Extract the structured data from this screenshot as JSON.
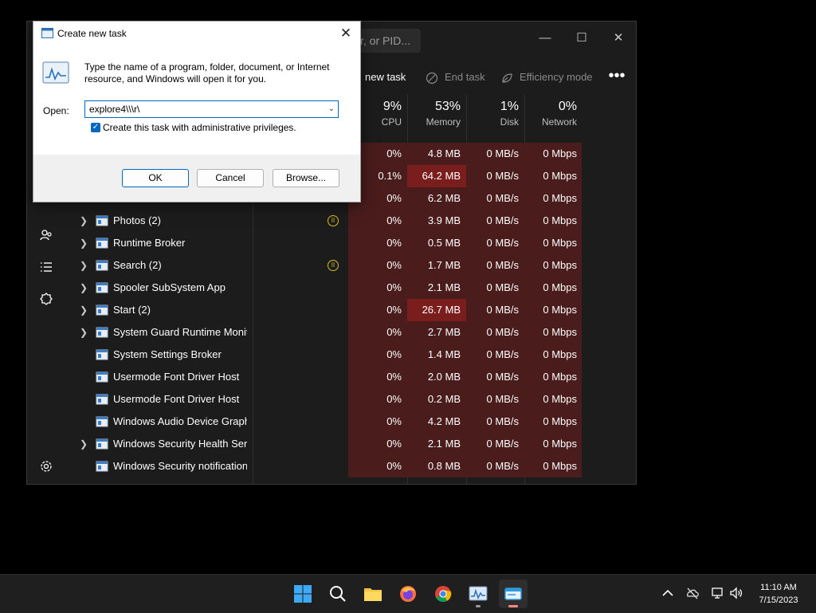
{
  "task_manager": {
    "search_placeholder": "r, or PID...",
    "toolbar": {
      "run_new_task": "new task",
      "end_task": "End task",
      "efficiency_mode": "Efficiency mode",
      "more": "•••"
    },
    "columns": [
      {
        "pct": "9%",
        "label": "CPU"
      },
      {
        "pct": "53%",
        "label": "Memory"
      },
      {
        "pct": "1%",
        "label": "Disk"
      },
      {
        "pct": "0%",
        "label": "Network"
      }
    ],
    "rows": [
      {
        "name": "",
        "expand": false,
        "cpu": "0%",
        "memory": "4.8 MB",
        "disk": "0 MB/s",
        "network": "0 Mbps",
        "mem_high": false,
        "paused": false
      },
      {
        "name": "",
        "expand": false,
        "cpu": "0.1%",
        "memory": "64.2 MB",
        "disk": "0 MB/s",
        "network": "0 Mbps",
        "mem_high": true,
        "paused": false
      },
      {
        "name": "",
        "expand": false,
        "cpu": "0%",
        "memory": "6.2 MB",
        "disk": "0 MB/s",
        "network": "0 Mbps",
        "mem_high": false,
        "paused": false
      },
      {
        "name": "Photos (2)",
        "expand": true,
        "cpu": "0%",
        "memory": "3.9 MB",
        "disk": "0 MB/s",
        "network": "0 Mbps",
        "mem_high": false,
        "paused": true
      },
      {
        "name": "Runtime Broker",
        "expand": true,
        "cpu": "0%",
        "memory": "0.5 MB",
        "disk": "0 MB/s",
        "network": "0 Mbps",
        "mem_high": false,
        "paused": false
      },
      {
        "name": "Search (2)",
        "expand": true,
        "cpu": "0%",
        "memory": "1.7 MB",
        "disk": "0 MB/s",
        "network": "0 Mbps",
        "mem_high": false,
        "paused": true
      },
      {
        "name": "Spooler SubSystem App",
        "expand": true,
        "cpu": "0%",
        "memory": "2.1 MB",
        "disk": "0 MB/s",
        "network": "0 Mbps",
        "mem_high": false,
        "paused": false
      },
      {
        "name": "Start (2)",
        "expand": true,
        "cpu": "0%",
        "memory": "26.7 MB",
        "disk": "0 MB/s",
        "network": "0 Mbps",
        "mem_high": true,
        "paused": false
      },
      {
        "name": "System Guard Runtime Monit...",
        "expand": true,
        "cpu": "0%",
        "memory": "2.7 MB",
        "disk": "0 MB/s",
        "network": "0 Mbps",
        "mem_high": false,
        "paused": false
      },
      {
        "name": "System Settings Broker",
        "expand": false,
        "cpu": "0%",
        "memory": "1.4 MB",
        "disk": "0 MB/s",
        "network": "0 Mbps",
        "mem_high": false,
        "paused": false
      },
      {
        "name": "Usermode Font Driver Host",
        "expand": false,
        "cpu": "0%",
        "memory": "2.0 MB",
        "disk": "0 MB/s",
        "network": "0 Mbps",
        "mem_high": false,
        "paused": false
      },
      {
        "name": "Usermode Font Driver Host",
        "expand": false,
        "cpu": "0%",
        "memory": "0.2 MB",
        "disk": "0 MB/s",
        "network": "0 Mbps",
        "mem_high": false,
        "paused": false
      },
      {
        "name": "Windows Audio Device Graph ...",
        "expand": false,
        "cpu": "0%",
        "memory": "4.2 MB",
        "disk": "0 MB/s",
        "network": "0 Mbps",
        "mem_high": false,
        "paused": false
      },
      {
        "name": "Windows Security Health Servi...",
        "expand": true,
        "cpu": "0%",
        "memory": "2.1 MB",
        "disk": "0 MB/s",
        "network": "0 Mbps",
        "mem_high": false,
        "paused": false
      },
      {
        "name": "Windows Security notification...",
        "expand": false,
        "cpu": "0%",
        "memory": "0.8 MB",
        "disk": "0 MB/s",
        "network": "0 Mbps",
        "mem_high": false,
        "paused": false
      }
    ]
  },
  "dialog": {
    "title": "Create new task",
    "description": "Type the name of a program, folder, document, or Internet resource, and Windows will open it for you.",
    "open_label": "Open:",
    "open_value": "explore4\\\\\\r\\",
    "admin_checkbox_label": "Create this task with administrative privileges.",
    "admin_checked": true,
    "ok": "OK",
    "cancel": "Cancel",
    "browse": "Browse..."
  },
  "taskbar": {
    "apps": [
      "start-icon",
      "search-icon",
      "file-explorer-icon",
      "firefox-icon",
      "chrome-icon",
      "task-manager-icon",
      "run-dialog-icon"
    ],
    "time": "11:10 AM",
    "date": "7/15/2023"
  },
  "colors": {
    "heat": "#4a1c1c",
    "heat_high": "#7a1d1d",
    "accent": "#0067c0"
  }
}
